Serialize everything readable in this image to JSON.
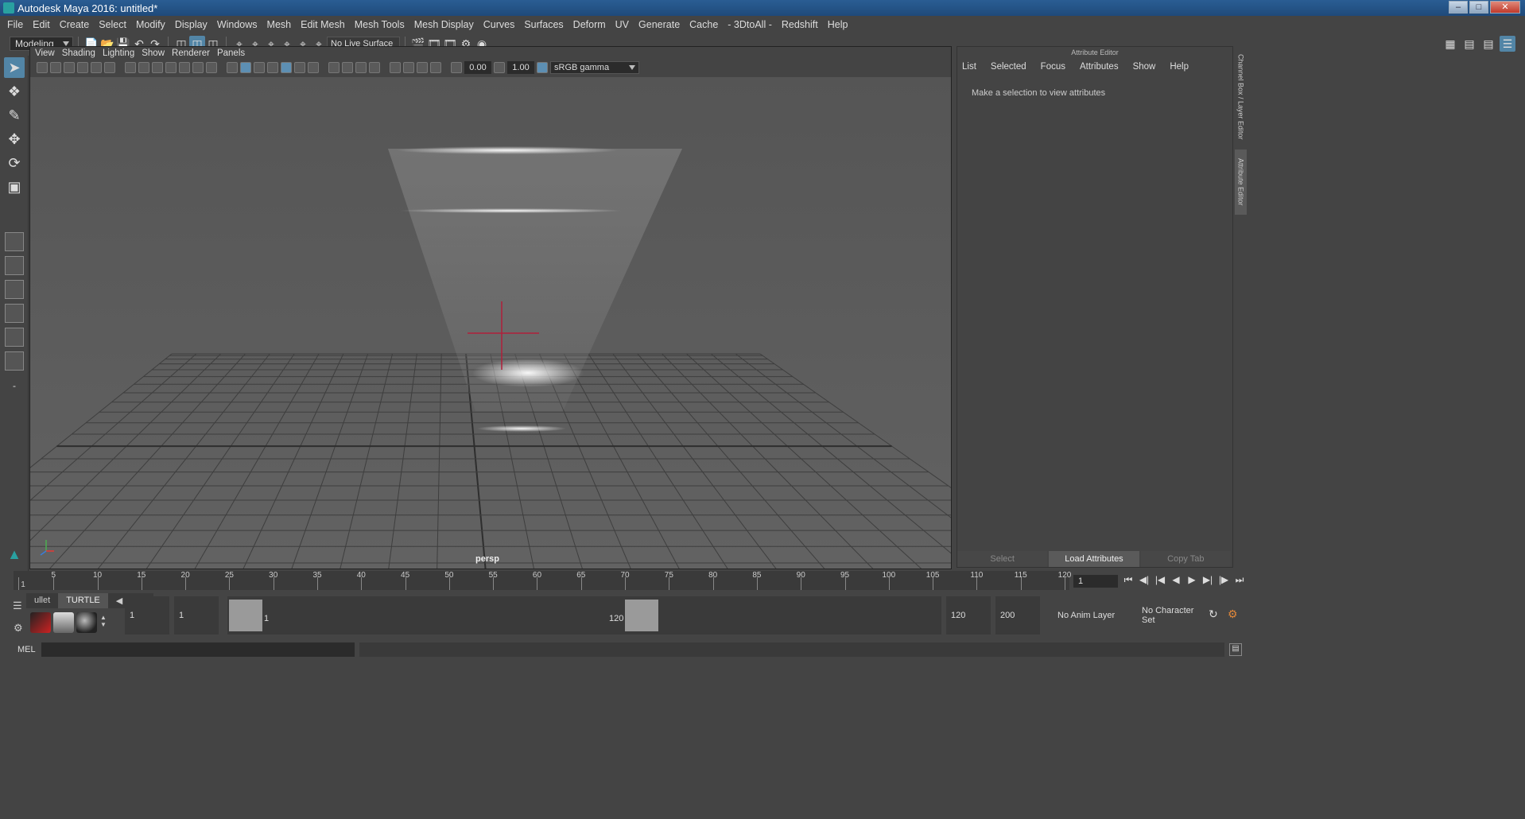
{
  "window": {
    "title": "Autodesk Maya 2016: untitled*"
  },
  "menubar": {
    "items": [
      "File",
      "Edit",
      "Create",
      "Select",
      "Modify",
      "Display",
      "Windows",
      "Mesh",
      "Edit Mesh",
      "Mesh Tools",
      "Mesh Display",
      "Curves",
      "Surfaces",
      "Deform",
      "UV",
      "Generate",
      "Cache",
      "- 3DtoAll -",
      "Redshift",
      "Help"
    ]
  },
  "statusline": {
    "mode": "Modeling",
    "live_surface": "No Live Surface"
  },
  "viewport": {
    "menu": [
      "View",
      "Shading",
      "Lighting",
      "Show",
      "Renderer",
      "Panels"
    ],
    "exposure": "0.00",
    "gamma_value": "1.00",
    "color_space": "sRGB gamma",
    "camera": "persp"
  },
  "attribute_editor": {
    "title": "Attribute Editor",
    "menu": [
      "List",
      "Selected",
      "Focus",
      "Attributes",
      "Show",
      "Help"
    ],
    "message": "Make a selection to view attributes",
    "buttons": [
      "Select",
      "Load Attributes",
      "Copy Tab"
    ]
  },
  "side_tabs": [
    "Channel Box / Layer Editor",
    "Attribute Editor"
  ],
  "timeline": {
    "ticks": [
      "1",
      "5",
      "10",
      "15",
      "20",
      "25",
      "30",
      "35",
      "40",
      "45",
      "50",
      "55",
      "60",
      "65",
      "70",
      "75",
      "80",
      "85",
      "90",
      "95",
      "100",
      "105",
      "110",
      "115",
      "120"
    ],
    "current_frame": "1"
  },
  "range": {
    "shelf_tabs": [
      "ullet",
      "TURTLE"
    ],
    "start_frame": "1",
    "anim_start": "1",
    "range_start": "1",
    "range_end": "120",
    "anim_end": "120",
    "end_frame": "200",
    "anim_layer": "No Anim Layer",
    "character_set": "No Character Set"
  },
  "cmdline": {
    "label": "MEL"
  }
}
